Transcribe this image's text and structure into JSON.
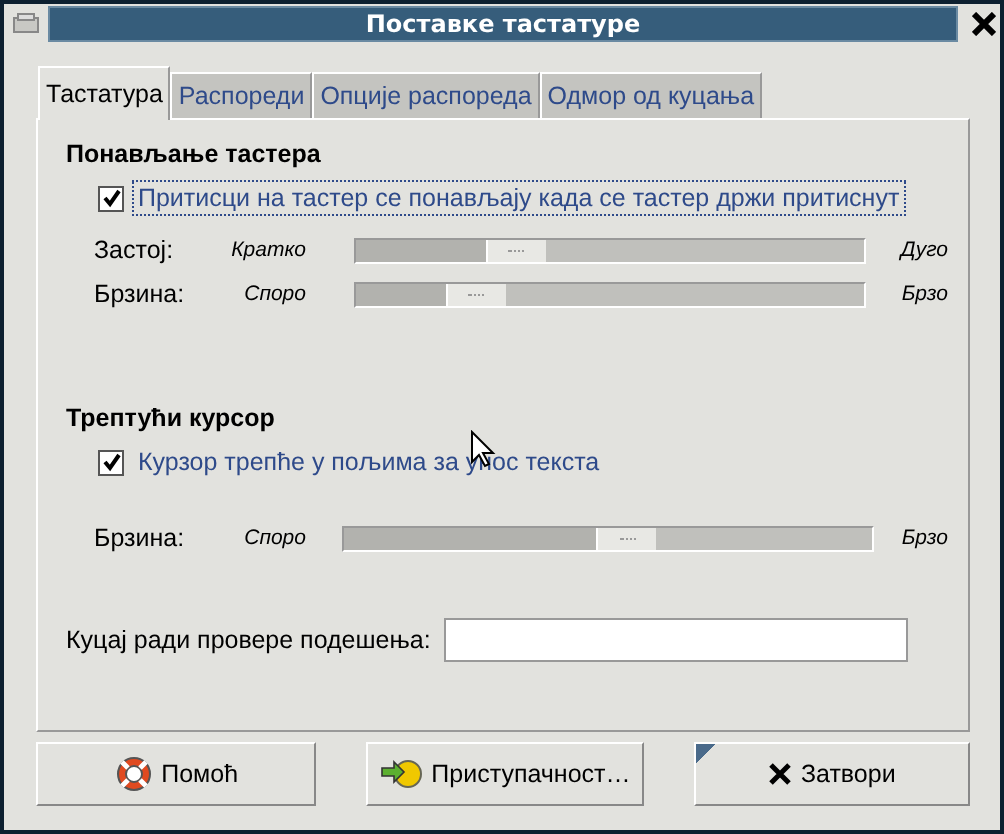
{
  "window": {
    "title": "Поставке тастатуре"
  },
  "tabs": [
    {
      "label": "Тастатура",
      "selected": true
    },
    {
      "label": "Распореди",
      "selected": false
    },
    {
      "label": "Опције распореда",
      "selected": false
    },
    {
      "label": "Одмор од куцања",
      "selected": false
    }
  ],
  "sections": [
    {
      "heading": "Понављање тастера",
      "checkbox": {
        "label": "Притисци на тастер се понављају када се тастер држи притиснут",
        "checked": true,
        "focused": true
      },
      "sliders": [
        {
          "label": "Застој:",
          "min_label": "Кратко",
          "max_label": "Дуго",
          "level": 0.29,
          "wide": false
        },
        {
          "label": "Брзина:",
          "min_label": "Споро",
          "max_label": "Брзо",
          "level": 0.2,
          "wide": false
        }
      ]
    },
    {
      "heading": "Трептући курсор",
      "checkbox": {
        "label": "Курзор трепће у пољима за унос текста",
        "checked": true,
        "focused": false
      },
      "sliders": [
        {
          "label": "Брзина:",
          "min_label": "Споро",
          "max_label": "Брзо",
          "level": 0.54,
          "wide": true
        }
      ]
    }
  ],
  "test_field": {
    "label": "Куцај ради провере подешења:"
  },
  "buttons": [
    {
      "label": "Помоћ",
      "kind": "help"
    },
    {
      "label": "Приступачност…",
      "kind": "access"
    },
    {
      "label": "Затвори",
      "kind": "close"
    }
  ]
}
